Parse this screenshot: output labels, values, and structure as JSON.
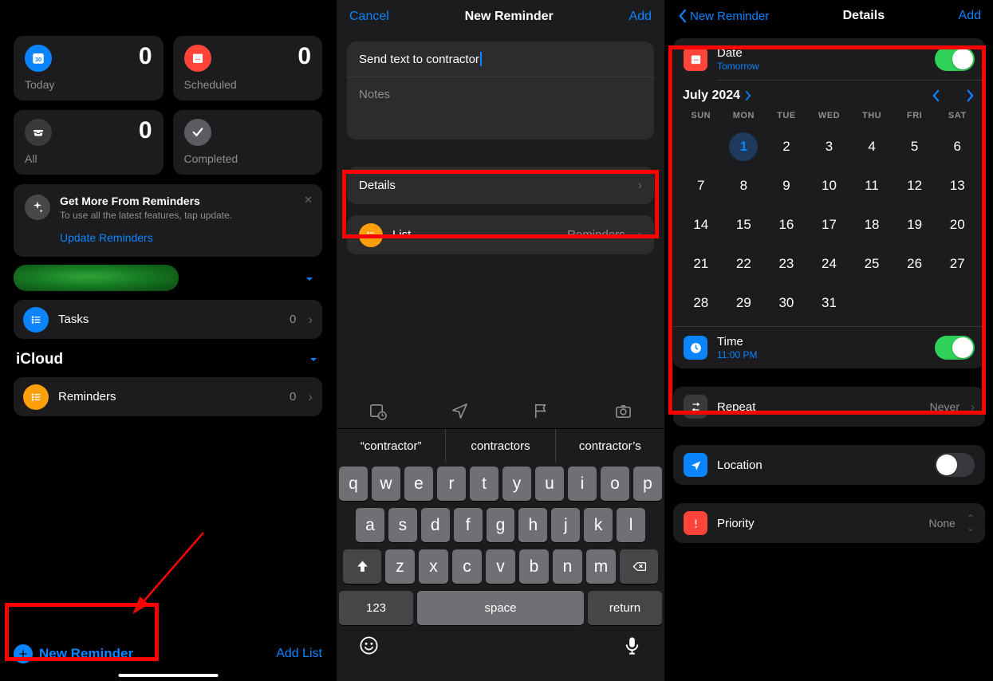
{
  "pane1": {
    "cards": [
      {
        "label": "Today",
        "count": "0",
        "icon": "calendar-today",
        "color": "blue"
      },
      {
        "label": "Scheduled",
        "count": "0",
        "icon": "calendar",
        "color": "red"
      },
      {
        "label": "All",
        "count": "0",
        "icon": "tray",
        "color": "gray"
      },
      {
        "label": "Completed",
        "count": "",
        "icon": "check",
        "color": "ggray"
      }
    ],
    "promo": {
      "title": "Get More From Reminders",
      "subtitle": "To use all the latest features, tap update.",
      "action": "Update Reminders"
    },
    "tasks_row": {
      "label": "Tasks",
      "count": "0"
    },
    "icloud_label": "iCloud",
    "reminders_row": {
      "label": "Reminders",
      "count": "0"
    },
    "new_reminder": "New Reminder",
    "add_list": "Add List"
  },
  "pane2": {
    "nav": {
      "cancel": "Cancel",
      "title": "New Reminder",
      "add": "Add"
    },
    "reminder_title": "Send text to contractor",
    "notes_placeholder": "Notes",
    "details_label": "Details",
    "list_row": {
      "label": "List",
      "value": "Reminders"
    },
    "suggestions": [
      "“contractor”",
      "contractors",
      "contractor’s"
    ],
    "keyboard": {
      "r1": [
        "q",
        "w",
        "e",
        "r",
        "t",
        "y",
        "u",
        "i",
        "o",
        "p"
      ],
      "r2": [
        "a",
        "s",
        "d",
        "f",
        "g",
        "h",
        "j",
        "k",
        "l"
      ],
      "r3": [
        "z",
        "x",
        "c",
        "v",
        "b",
        "n",
        "m"
      ],
      "num": "123",
      "space": "space",
      "ret": "return"
    }
  },
  "pane3": {
    "nav": {
      "back": "New Reminder",
      "title": "Details",
      "add": "Add"
    },
    "date": {
      "label": "Date",
      "value": "Tomorrow",
      "on": true
    },
    "calendar": {
      "month": "July 2024",
      "dow": [
        "SUN",
        "MON",
        "TUE",
        "WED",
        "THU",
        "FRI",
        "SAT"
      ],
      "selected": 1,
      "days": [
        [
          "",
          "1",
          "2",
          "3",
          "4",
          "5",
          "6"
        ],
        [
          "7",
          "8",
          "9",
          "10",
          "11",
          "12",
          "13"
        ],
        [
          "14",
          "15",
          "16",
          "17",
          "18",
          "19",
          "20"
        ],
        [
          "21",
          "22",
          "23",
          "24",
          "25",
          "26",
          "27"
        ],
        [
          "28",
          "29",
          "30",
          "31",
          "",
          "",
          ""
        ]
      ]
    },
    "time": {
      "label": "Time",
      "value": "11:00 PM",
      "on": true
    },
    "repeat": {
      "label": "Repeat",
      "value": "Never"
    },
    "location": {
      "label": "Location",
      "on": false
    },
    "priority": {
      "label": "Priority",
      "value": "None"
    }
  }
}
